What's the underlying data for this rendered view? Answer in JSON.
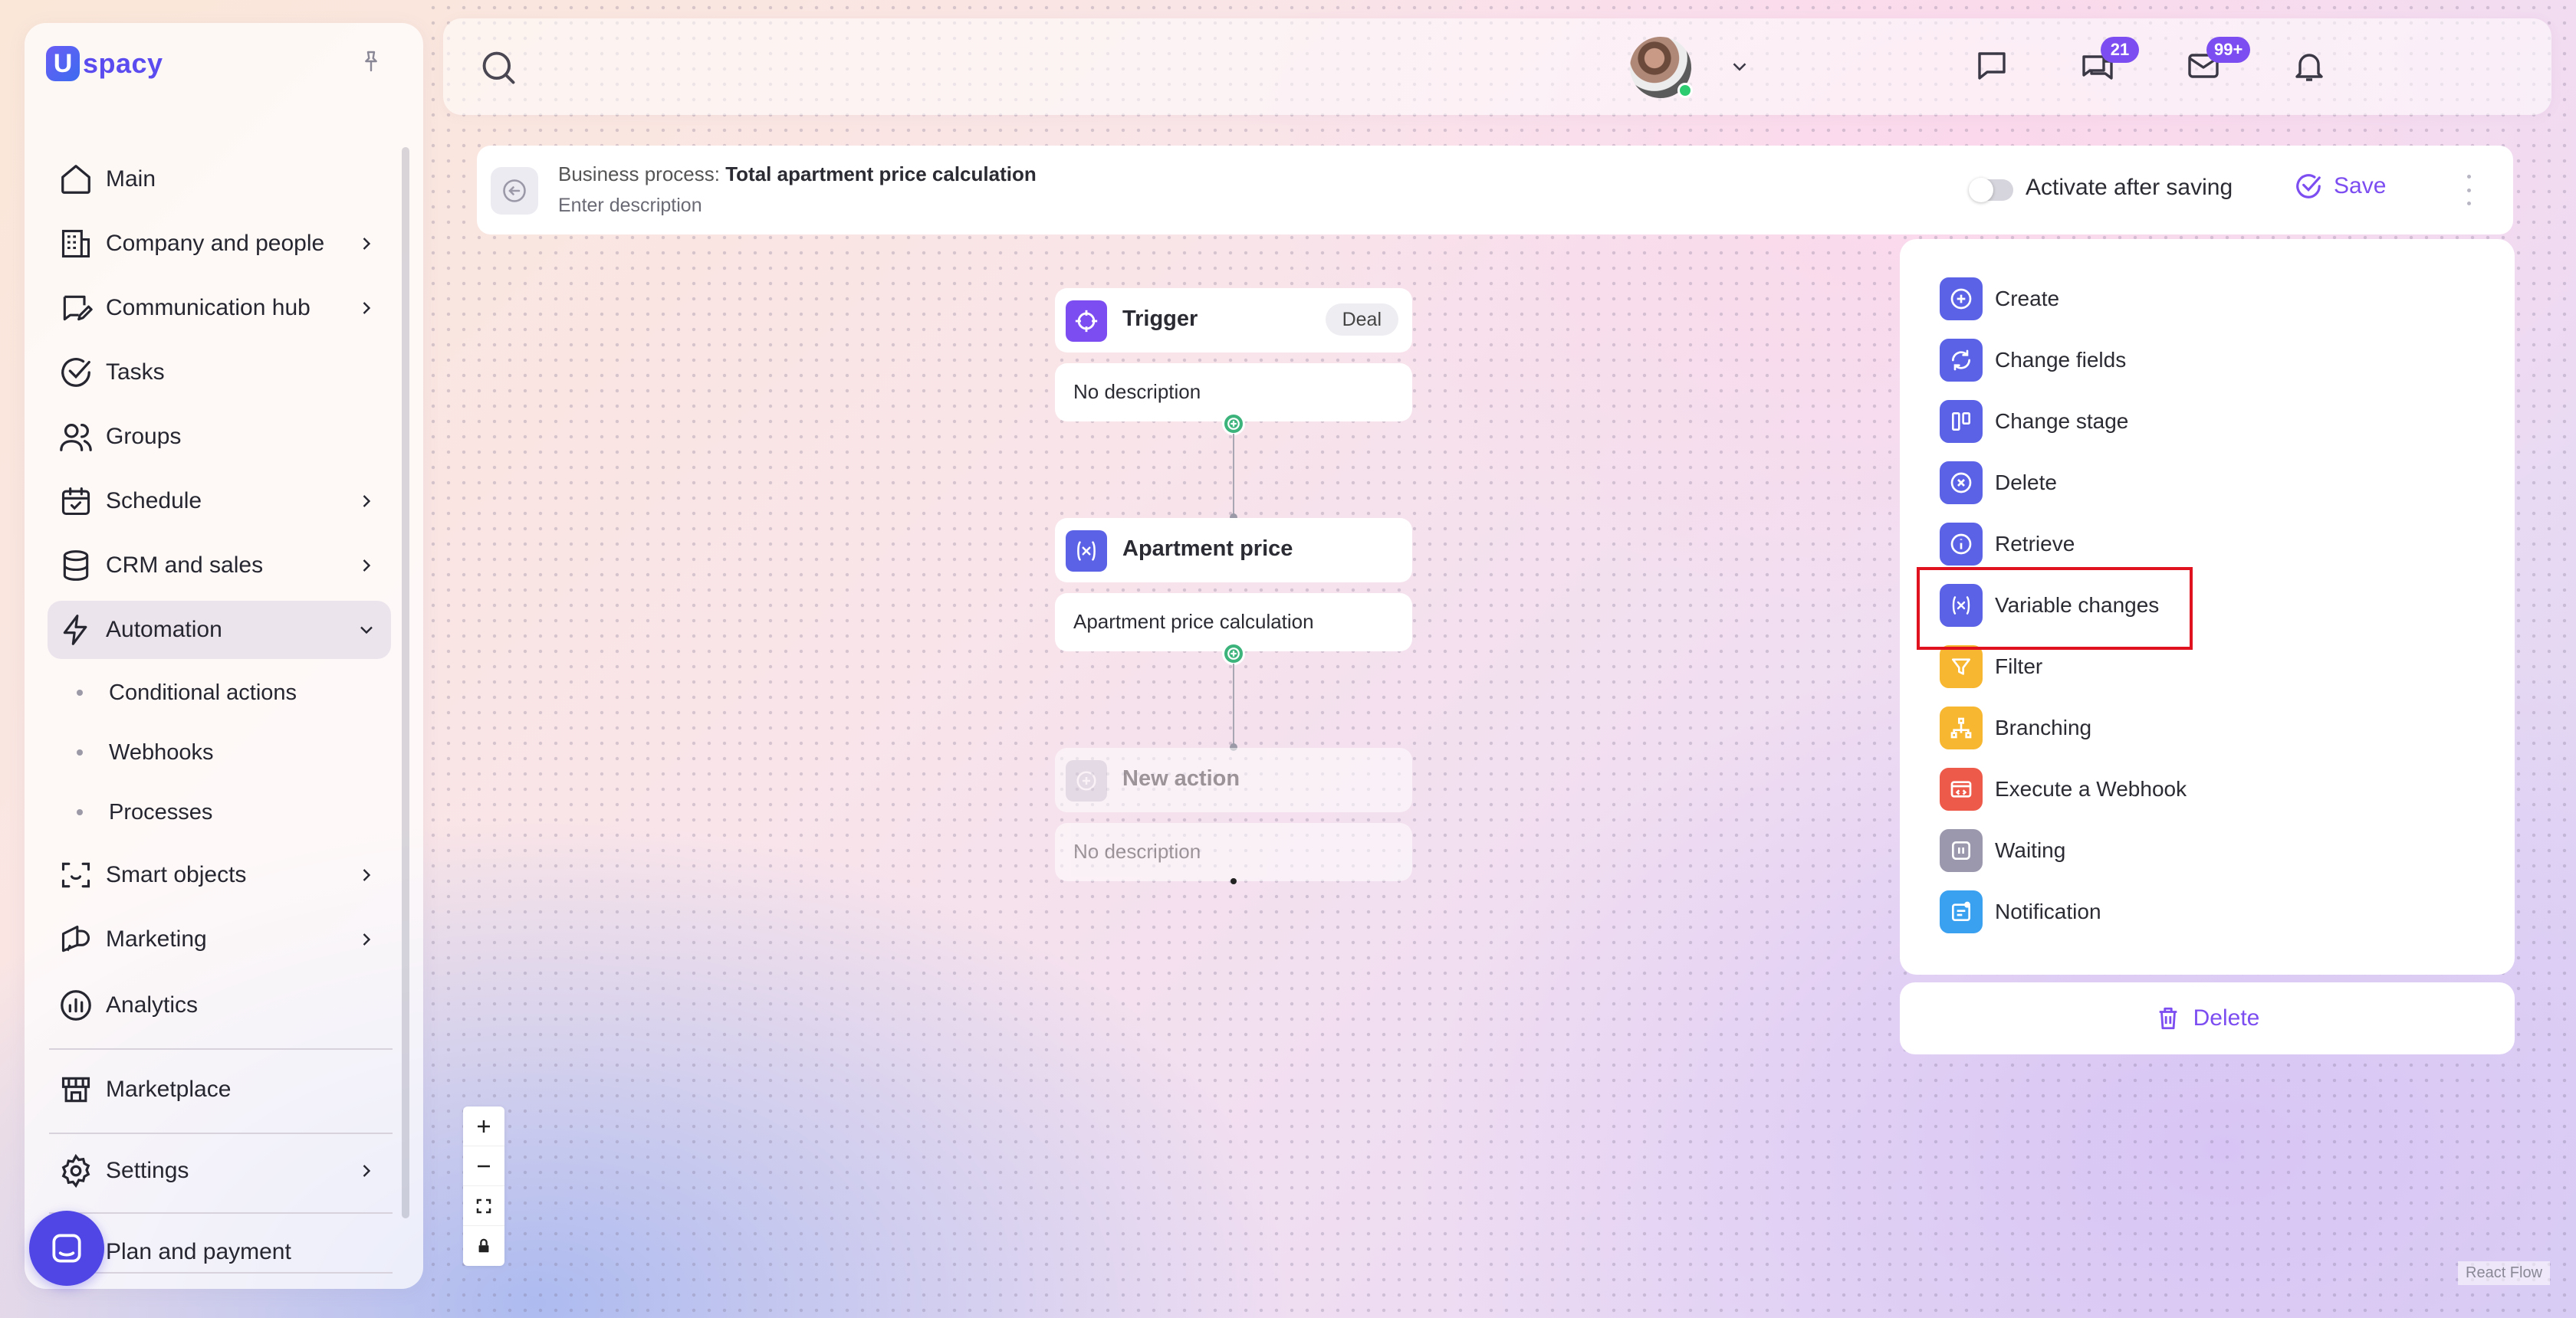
{
  "app": {
    "logo_letter": "U",
    "logo_text": "spacy",
    "brand_color": "#5b4cf0",
    "accent_color": "#7c4df0"
  },
  "sidebar": {
    "items": [
      {
        "label": "Main",
        "icon": "home-icon"
      },
      {
        "label": "Company and people",
        "icon": "building-icon"
      },
      {
        "label": "Communication hub",
        "icon": "chat-edit-icon"
      },
      {
        "label": "Tasks",
        "icon": "check-circle-icon"
      },
      {
        "label": "Groups",
        "icon": "users-icon"
      },
      {
        "label": "Schedule",
        "icon": "calendar-icon"
      },
      {
        "label": "CRM and sales",
        "icon": "database-icon"
      },
      {
        "label": "Automation",
        "icon": "bolt-icon"
      },
      {
        "label": "Smart objects",
        "icon": "scan-icon"
      },
      {
        "label": "Marketing",
        "icon": "megaphone-icon"
      },
      {
        "label": "Analytics",
        "icon": "chart-icon"
      },
      {
        "label": "Marketplace",
        "icon": "store-icon"
      },
      {
        "label": "Settings",
        "icon": "gear-icon"
      },
      {
        "label": "Plan and payment",
        "icon": "card-icon"
      }
    ],
    "automation_sub": [
      "Conditional actions",
      "Webhooks",
      "Processes"
    ]
  },
  "topbar": {
    "chat_badge": "21",
    "mail_badge": "99+"
  },
  "process": {
    "title_prefix": "Business process:",
    "title": "Total apartment price calculation",
    "description_placeholder": "Enter description",
    "activate_label": "Activate after saving",
    "save_label": "Save"
  },
  "flow": {
    "nodes": [
      {
        "title": "Trigger",
        "tag": "Deal",
        "description": "No description"
      },
      {
        "title": "Apartment price",
        "description": "Apartment price calculation"
      },
      {
        "title": "New action",
        "description": "No description"
      }
    ]
  },
  "actions": {
    "items": [
      {
        "label": "Create",
        "color": "#5b62e6"
      },
      {
        "label": "Change fields",
        "color": "#5b62e6"
      },
      {
        "label": "Change stage",
        "color": "#5b62e6"
      },
      {
        "label": "Delete",
        "color": "#5b62e6"
      },
      {
        "label": "Retrieve",
        "color": "#5b62e6"
      },
      {
        "label": "Variable changes",
        "color": "#5b62e6"
      },
      {
        "label": "Filter",
        "color": "#f7b731"
      },
      {
        "label": "Branching",
        "color": "#f7b731"
      },
      {
        "label": "Execute a Webhook",
        "color": "#ee5a4a"
      },
      {
        "label": "Waiting",
        "color": "#9b98ae"
      },
      {
        "label": "Notification",
        "color": "#3aa0f0"
      }
    ],
    "delete_label": "Delete"
  },
  "canvas": {
    "attribution": "React Flow"
  }
}
